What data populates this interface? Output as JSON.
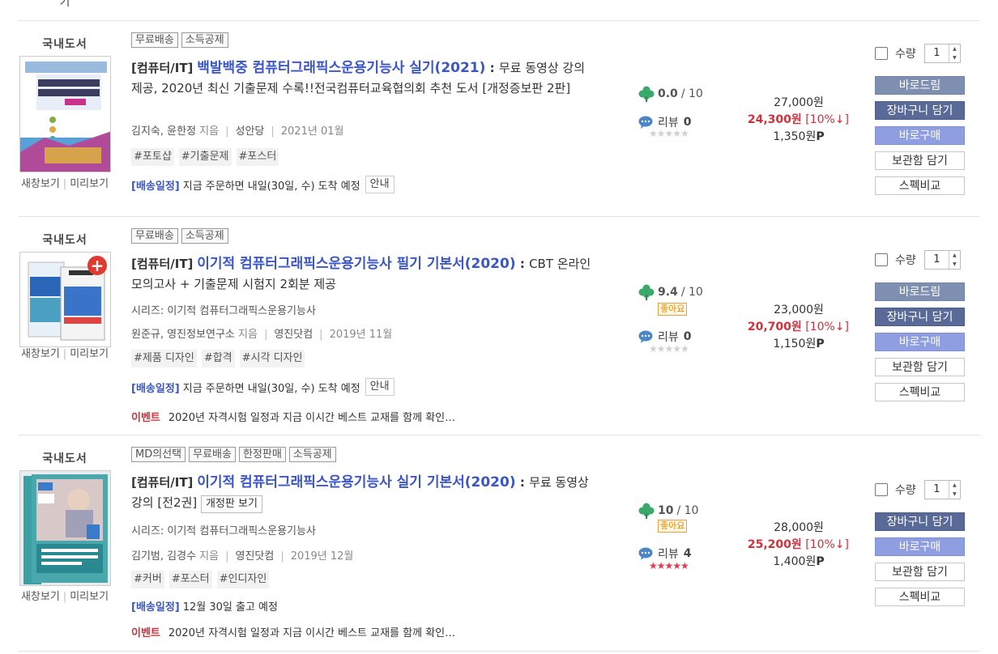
{
  "top_fragment": "기",
  "items": [
    {
      "category": "국내도서",
      "badges": [
        "무료배송",
        "소득공제"
      ],
      "cat_label": "[컴퓨터/IT]",
      "title": "백발백중 컴퓨터그래픽스운용기능사 실기(2021)",
      "title_colon": " : ",
      "subtitle": "무료 동영상 강의 제공, 2020년 최신 기출문제 수록!!전국컴퓨터교육협의회 추천 도서 [개정증보판 2판]",
      "series": "",
      "authors": "김지숙, 윤한정",
      "author_suffix": "지음",
      "publisher": "성안당",
      "date": "2021년 01월",
      "tags": [
        "#포토샵",
        "#기출문제",
        "#포스터"
      ],
      "ship_label": "[배송일정]",
      "ship_text": "지금 주문하면 내일(30일, 수) 도착 예정",
      "ship_guide": "안내",
      "event_label": "",
      "event_text": "",
      "score": "0.0",
      "score_max": "/ 10",
      "good_tag": "",
      "review_label": "리뷰",
      "review_count": "0",
      "stars": "★★★★★",
      "price_orig": "27,000원",
      "price_sale": "24,300원",
      "discount": "[10%↓]",
      "points": "1,350원",
      "points_unit": "P",
      "qty_label": "수량",
      "qty_value": "1",
      "buttons": [
        "바로드림",
        "장바구니 담기",
        "바로구매",
        "보관함 담기",
        "스펙비교"
      ],
      "view_new": "새창보기",
      "view_preview": "미리보기"
    },
    {
      "category": "국내도서",
      "badges": [
        "무료배송",
        "소득공제"
      ],
      "cat_label": "[컴퓨터/IT]",
      "title": "이기적 컴퓨터그래픽스운용기능사 필기 기본서(2020)",
      "title_colon": " : ",
      "subtitle": "CBT 온라인 모의고사 + 기출문제 시험지 2회분 제공",
      "series": "시리즈: 이기적 컴퓨터그래픽스운용기능사",
      "authors": "원준규, 영진정보연구소",
      "author_suffix": "지음",
      "publisher": "영진닷컴",
      "date": "2019년 11월",
      "tags": [
        "#제품 디자인",
        "#합격",
        "#시각 디자인"
      ],
      "ship_label": "[배송일정]",
      "ship_text": "지금 주문하면 내일(30일, 수) 도착 예정",
      "ship_guide": "안내",
      "event_label": "이벤트",
      "event_text": "2020년 자격시험 일정과 지금 이시간 베스트 교재를 함께 확인…",
      "score": "9.4",
      "score_max": "/ 10",
      "good_tag": "좋아요",
      "review_label": "리뷰",
      "review_count": "0",
      "stars": "★★★★★",
      "price_orig": "23,000원",
      "price_sale": "20,700원",
      "discount": "[10%↓]",
      "points": "1,150원",
      "points_unit": "P",
      "qty_label": "수량",
      "qty_value": "1",
      "buttons": [
        "바로드림",
        "장바구니 담기",
        "바로구매",
        "보관함 담기",
        "스펙비교"
      ],
      "view_new": "새창보기",
      "view_preview": "미리보기"
    },
    {
      "category": "국내도서",
      "badges": [
        "MD의선택",
        "무료배송",
        "한정판매",
        "소득공제"
      ],
      "cat_label": "[컴퓨터/IT]",
      "title": "이기적 컴퓨터그래픽스운용기능사 실기 기본서(2020)",
      "title_colon": " : ",
      "subtitle": "무료 동영상 강의 [전2권]",
      "revision_btn": "개정판 보기",
      "series": "시리즈: 이기적 컴퓨터그래픽스운용기능사",
      "authors": "김기범, 김경수",
      "author_suffix": "지음",
      "publisher": "영진닷컴",
      "date": "2019년 12월",
      "tags": [
        "#커버",
        "#포스터",
        "#인디자인"
      ],
      "ship_label": "[배송일정]",
      "ship_text": "12월 30일 출고 예정",
      "ship_guide": "",
      "event_label": "이벤트",
      "event_text": "2020년 자격시험 일정과 지금 이시간 베스트 교재를 함께 확인…",
      "score": "10",
      "score_max": "/ 10",
      "good_tag": "좋아요",
      "review_label": "리뷰",
      "review_count": "4",
      "stars": "★★★★★",
      "price_orig": "28,000원",
      "price_sale": "25,200원",
      "discount": "[10%↓]",
      "points": "1,400원",
      "points_unit": "P",
      "qty_label": "수량",
      "qty_value": "1",
      "buttons": [
        "장바구니 담기",
        "바로구매",
        "보관함 담기",
        "스펙비교"
      ],
      "view_new": "새창보기",
      "view_preview": "미리보기"
    }
  ],
  "colors": {
    "title_link": "#3a56c8",
    "sale_price": "#d0323c",
    "event": "#d0323c",
    "good_tag": "#e48a00"
  }
}
